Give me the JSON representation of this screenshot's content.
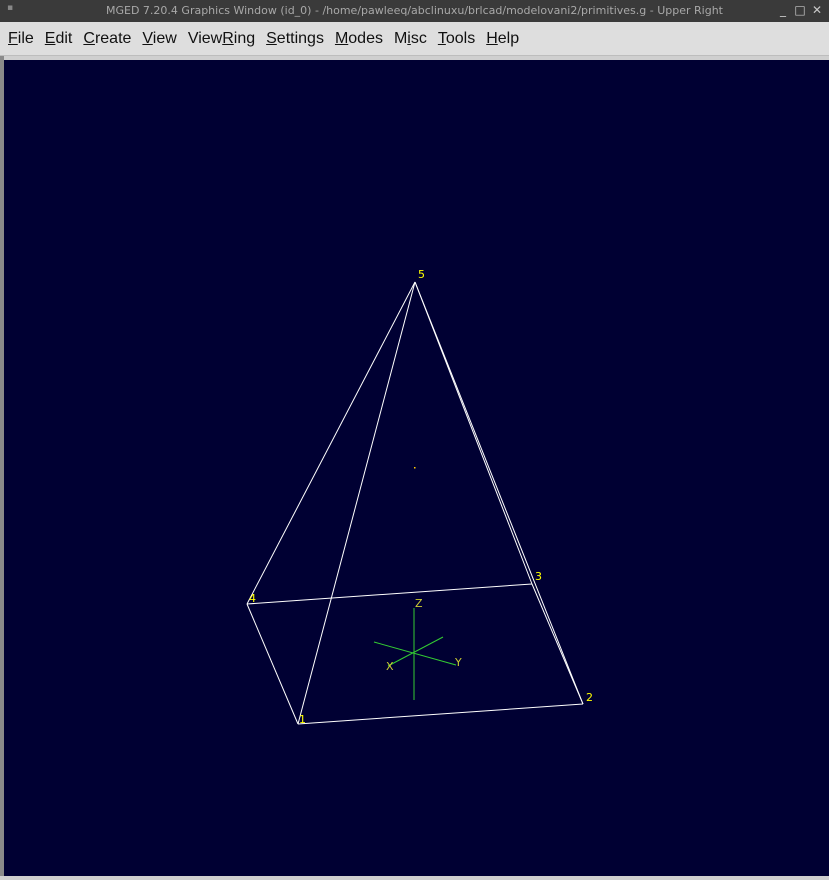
{
  "window": {
    "title": "MGED 7.20.4 Graphics Window (id_0) - /home/pawleeq/abclinuxu/brlcad/modelovani2/primitives.g - Upper Right",
    "buttons": {
      "minimize": "_",
      "maximize": "□",
      "close": "✕"
    }
  },
  "menu": [
    {
      "pre": "",
      "acc": "F",
      "post": "ile"
    },
    {
      "pre": "",
      "acc": "E",
      "post": "dit"
    },
    {
      "pre": "",
      "acc": "C",
      "post": "reate"
    },
    {
      "pre": "",
      "acc": "V",
      "post": "iew"
    },
    {
      "pre": "View",
      "acc": "R",
      "post": "ing"
    },
    {
      "pre": "",
      "acc": "S",
      "post": "ettings"
    },
    {
      "pre": "",
      "acc": "M",
      "post": "odes"
    },
    {
      "pre": "M",
      "acc": "i",
      "post": "sc"
    },
    {
      "pre": "",
      "acc": "T",
      "post": "ools"
    },
    {
      "pre": "",
      "acc": "H",
      "post": "elp"
    }
  ],
  "viewport": {
    "background": "#000033",
    "wire_color": "#ffffff",
    "label_color": "#ffff00",
    "axis_color": "#33cc33",
    "vertex_labels": [
      "1",
      "2",
      "3",
      "4",
      "5"
    ],
    "axis_labels": {
      "x": "X",
      "y": "Y",
      "z": "Z"
    }
  }
}
